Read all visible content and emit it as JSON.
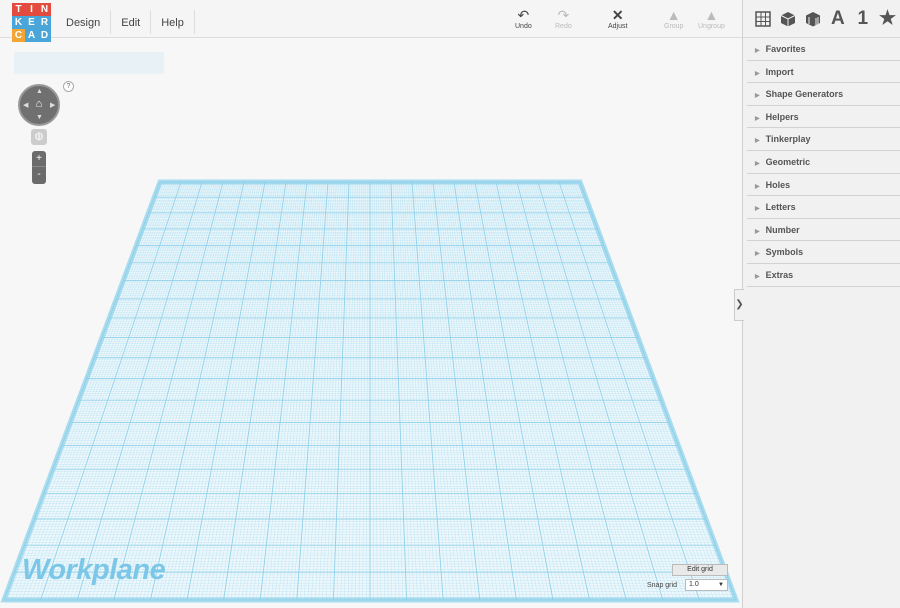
{
  "logo": {
    "letters": [
      "T",
      "I",
      "N",
      "K",
      "E",
      "R",
      "C",
      "A",
      "D"
    ],
    "colors": [
      "#e24b3d",
      "#e24b3d",
      "#e24b3d",
      "#4aa6d8",
      "#4aa6d8",
      "#4aa6d8",
      "#f3a533",
      "#4aa6d8",
      "#4aa6d8"
    ]
  },
  "menu": {
    "items": [
      "Design",
      "Edit",
      "Help"
    ]
  },
  "toolbar": {
    "undo": {
      "label": "Undo",
      "icon": "undo-icon"
    },
    "redo": {
      "label": "Redo",
      "icon": "redo-icon"
    },
    "adjust": {
      "label": "Adjust",
      "icon": "adjust-icon"
    },
    "group": {
      "label": "Group",
      "icon": "group-icon"
    },
    "ungroup": {
      "label": "Ungroup",
      "icon": "ungroup-icon"
    }
  },
  "viewport": {
    "help": "?",
    "home": "⌂",
    "zoom_in": "+",
    "zoom_out": "-",
    "workplane_label": "Workplane",
    "edit_grid_label": "Edit grid",
    "snap_grid_label": "Snap grid",
    "snap_grid_value": "1.0",
    "collapse": "❯",
    "grid_color": "#8ccfe8"
  },
  "sidebar": {
    "tabs": [
      "grid-icon",
      "cube-icon",
      "striped-cube-icon",
      "A",
      "1",
      "★"
    ],
    "sections": [
      "Favorites",
      "Import",
      "Shape Generators",
      "Helpers",
      "Tinkerplay",
      "Geometric",
      "Holes",
      "Letters",
      "Number",
      "Symbols",
      "Extras"
    ]
  }
}
